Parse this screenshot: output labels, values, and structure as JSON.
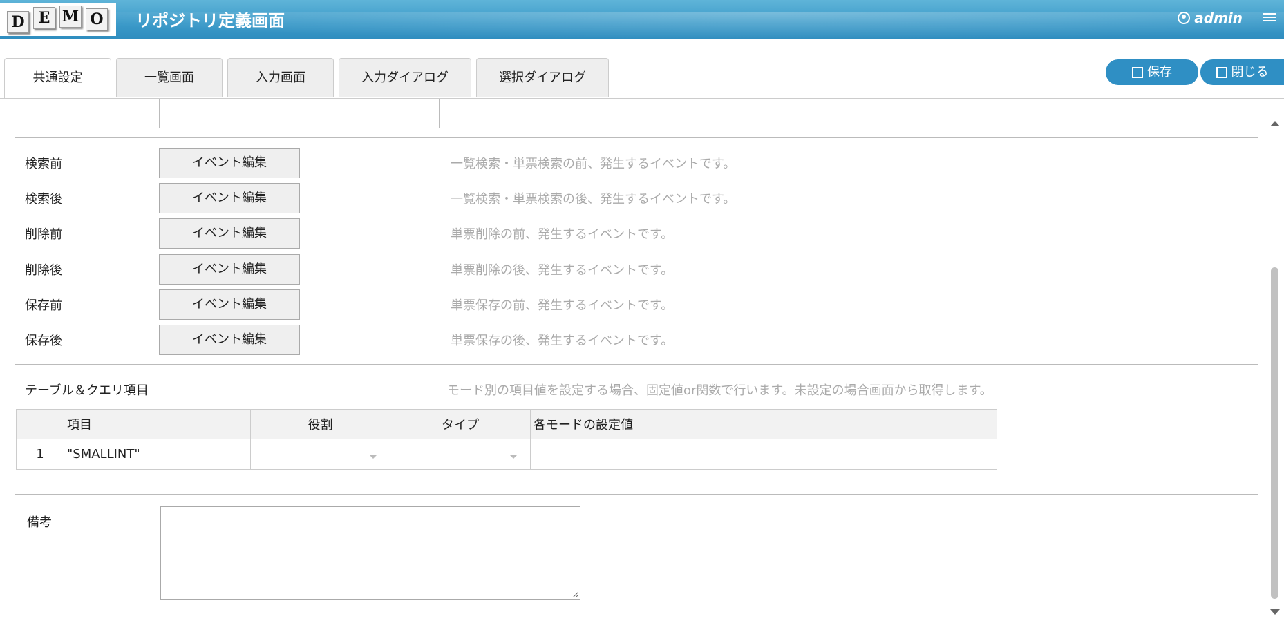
{
  "header": {
    "logo_letters": [
      "D",
      "E",
      "M",
      "O"
    ],
    "title": "リポジトリ定義画面",
    "user": "admin"
  },
  "tabs": [
    {
      "label": "共通設定",
      "active": true
    },
    {
      "label": "一覧画面",
      "active": false
    },
    {
      "label": "入力画面",
      "active": false
    },
    {
      "label": "入力ダイアログ",
      "active": false
    },
    {
      "label": "選択ダイアログ",
      "active": false
    }
  ],
  "toolbar": {
    "save_label": "保存",
    "close_label": "閉じる"
  },
  "events": [
    {
      "label": "検索前",
      "button": "イベント編集",
      "description": "一覧検索・単票検索の前、発生するイベントです。"
    },
    {
      "label": "検索後",
      "button": "イベント編集",
      "description": "一覧検索・単票検索の後、発生するイベントです。"
    },
    {
      "label": "削除前",
      "button": "イベント編集",
      "description": "単票削除の前、発生するイベントです。"
    },
    {
      "label": "削除後",
      "button": "イベント編集",
      "description": "単票削除の後、発生するイベントです。"
    },
    {
      "label": "保存前",
      "button": "イベント編集",
      "description": "単票保存の前、発生するイベントです。"
    },
    {
      "label": "保存後",
      "button": "イベント編集",
      "description": "単票保存の後、発生するイベントです。"
    }
  ],
  "table_section": {
    "label": "テーブル＆クエリ項目",
    "description": "モード別の項目値を設定する場合、固定値or関数で行います。未設定の場合画面から取得します。",
    "columns": [
      "",
      "項目",
      "役割",
      "タイプ",
      "各モードの設定値"
    ],
    "rows": [
      {
        "num": "1",
        "item": "\"SMALLINT\"",
        "role": "",
        "type": "",
        "mode_value": ""
      }
    ]
  },
  "remarks": {
    "label": "備考",
    "value": ""
  }
}
